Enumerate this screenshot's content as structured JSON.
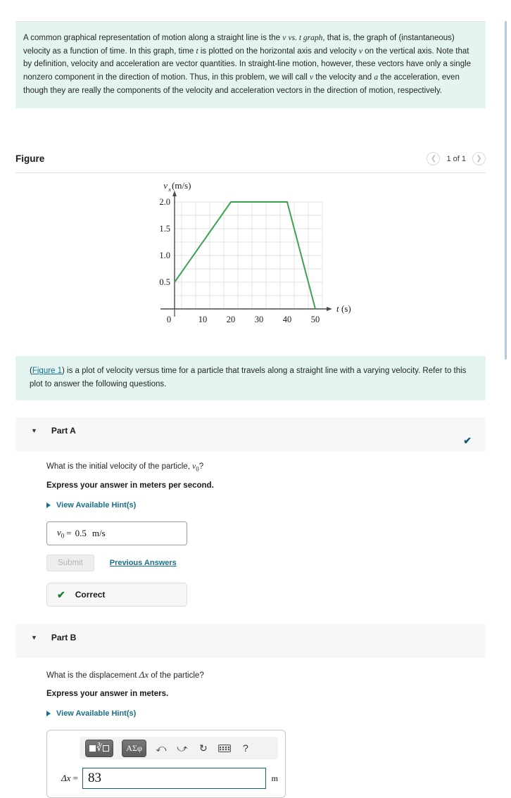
{
  "intro": {
    "text": "A common graphical representation of motion along a straight line is the v vs. t graph, that is, the graph of (instantaneous) velocity as a function of time. In this graph, time t is plotted on the horizontal axis and velocity v on the vertical axis. Note that by definition, velocity and acceleration are vector quantities. In straight-line motion, however, these vectors have only a single nonzero component in the direction of motion. Thus, in this problem, we will call v the velocity and a the acceleration, even though they are really the components of the velocity and acceleration vectors in the direction of motion, respectively."
  },
  "figure": {
    "title": "Figure",
    "pager_count": "1 of 1",
    "prev_icon": "chevron-left-icon",
    "next_icon": "chevron-right-icon"
  },
  "chart_data": {
    "type": "line",
    "title": "",
    "xlabel": "t (s)",
    "ylabel": "v_x (m/s)",
    "xlim": [
      0,
      55
    ],
    "ylim": [
      0,
      2.25
    ],
    "xticks": [
      0,
      10,
      20,
      30,
      40,
      50
    ],
    "xticklabels": [
      "0",
      "10",
      "20",
      "30",
      "40",
      "50"
    ],
    "yticks": [
      0.5,
      1.0,
      1.5,
      2.0
    ],
    "yticklabels": [
      "0.5",
      "1.0",
      "1.5",
      "2.0"
    ],
    "grid": true,
    "grid_x_step": 5,
    "grid_y_step": 0.25,
    "line_color": "#3ba34d",
    "series": [
      {
        "name": "v_x",
        "x": [
          0,
          20,
          40,
          50
        ],
        "values": [
          0.5,
          2.0,
          2.0,
          0.0
        ]
      }
    ]
  },
  "prompt": {
    "link_text": "Figure 1",
    "lead": "(",
    "after_link": ") is a plot of velocity versus time for a particle that travels along a straight line with a varying velocity. Refer to this plot to answer the following questions."
  },
  "part_a": {
    "label": "Part A",
    "caret_icon": "caret-down-icon",
    "status_icon": "check-icon",
    "question": "What is the initial velocity of the particle, v0 ?",
    "instruction": "Express your answer in meters per second.",
    "hint_label": "View Available Hint(s)",
    "answer_var": "v",
    "answer_sub": "0",
    "answer_eq": "=",
    "answer_value": "0.5",
    "answer_unit": "m/s",
    "submit_label": "Submit",
    "previous_answers_label": "Previous Answers",
    "feedback_label": "Correct",
    "feedback_icon": "check-icon"
  },
  "part_b": {
    "label": "Part B",
    "caret_icon": "caret-down-icon",
    "question_pre": "What is the displacement ",
    "question_sym": "Δx",
    "question_post": " of the particle?",
    "instruction": "Express your answer in meters.",
    "hint_label": "View Available Hint(s)",
    "toolbar": {
      "template_button": "template-icon",
      "greek_button": "ΑΣφ",
      "undo_icon": "undo-arrow-icon",
      "redo_icon": "redo-arrow-icon",
      "reset_icon": "reset-circle-icon",
      "keyboard_icon": "keyboard-icon",
      "help_icon": "?"
    },
    "answer_label": "Δx =",
    "answer_value": "83",
    "answer_unit": "m"
  },
  "colors": {
    "accent_teal": "#16708c",
    "cyan_box": "#e3f4f1",
    "green_line": "#3ba34d",
    "correct_green": "#118033"
  }
}
